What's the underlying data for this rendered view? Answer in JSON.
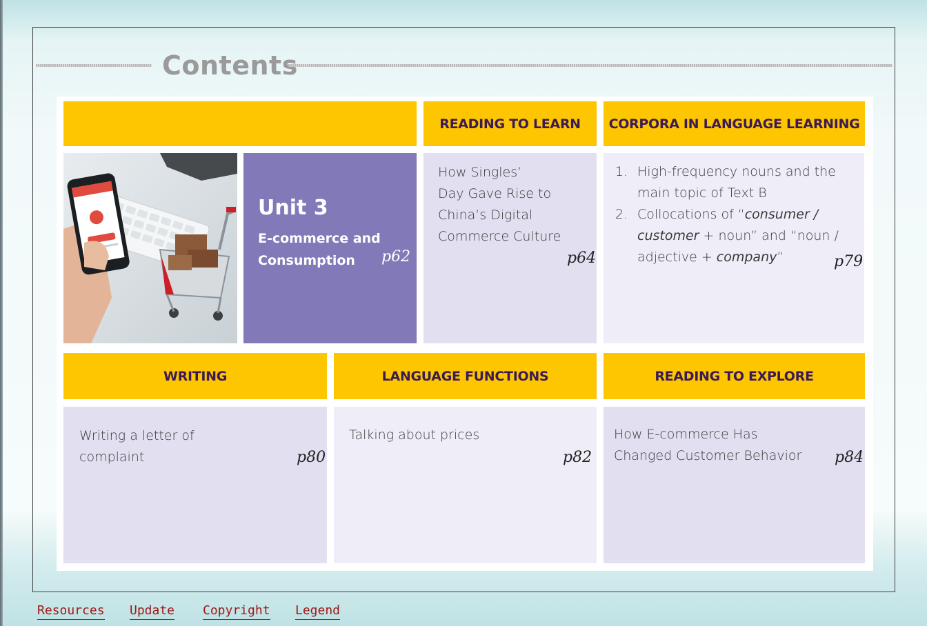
{
  "title": "Contents",
  "header_row1": {
    "reading_to_learn": "READING TO LEARN",
    "corpora": "CORPORA IN LANGUAGE LEARNING"
  },
  "unit": {
    "title": "Unit 3",
    "subtitle_line1": "E-commerce and",
    "subtitle_line2": "Consumption",
    "page": "p62"
  },
  "reading_to_learn": {
    "lines": [
      "How Singles’",
      "Day Gave Rise to",
      "China’s Digital",
      "Commerce Culture"
    ],
    "page": "p64"
  },
  "corpora": {
    "item1": "High-frequency nouns and the main topic of Text B",
    "item2_a": "Collocations of “",
    "item2_b": "consumer /",
    "item2_c": "customer",
    "item2_d": " + noun” and “noun / adjective + ",
    "item2_e": "company",
    "item2_f": "”",
    "page": "p79"
  },
  "header_row2": {
    "writing": "WRITING",
    "language_functions": "LANGUAGE FUNCTIONS",
    "reading_to_explore": "READING TO EXPLORE"
  },
  "writing": {
    "line1": "Writing a letter of",
    "line2": "complaint",
    "page": "p80"
  },
  "language_functions": {
    "line1": "Talking about prices",
    "page": "p82"
  },
  "reading_to_explore": {
    "line1": "How E-commerce Has",
    "line2": "Changed Customer Behavior",
    "page": "p84"
  },
  "footer": [
    "Resources",
    "Update",
    "Copyright",
    "Legend"
  ],
  "colors": {
    "header_yellow": "#fdc600",
    "header_text": "#3b1a55",
    "unit_purple": "#8279b8",
    "link_red": "#a01818"
  }
}
